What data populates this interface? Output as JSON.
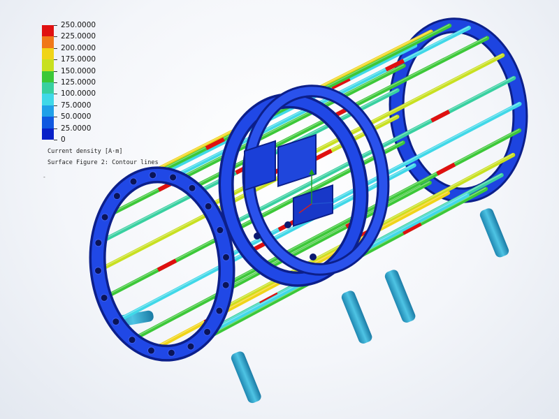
{
  "legend": {
    "colors": [
      "#e01010",
      "#f07818",
      "#f0d418",
      "#c8e020",
      "#3cc838",
      "#38d0a0",
      "#40d8e8",
      "#20a0e8",
      "#1058e0",
      "#0820c8"
    ],
    "tick_labels": [
      "250.0000",
      "225.0000",
      "200.0000",
      "175.0000",
      "150.0000",
      "125.0000",
      "100.0000",
      "75.0000",
      "50.0000",
      "25.0000",
      "0"
    ]
  },
  "caption": {
    "quantity": "Current density [A⋅m]",
    "figure": "Surface Figure 2: Contour lines"
  },
  "stray_mark": "-",
  "model": {
    "ring_color": "#1a3fd8",
    "ring_dark": "#0c1f8a",
    "rod_base_color": "#36c8e6",
    "leg_color": "#2fa8d0"
  }
}
